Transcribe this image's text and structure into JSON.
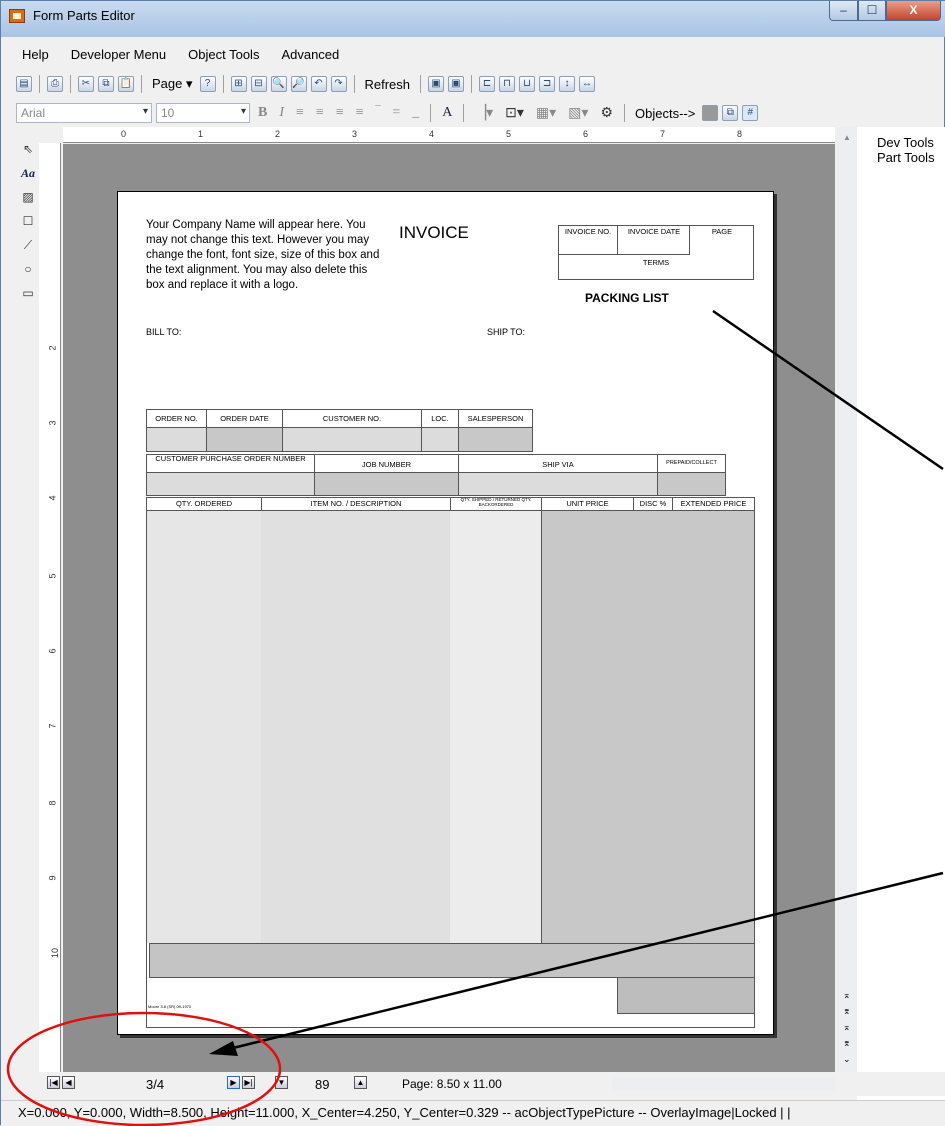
{
  "window": {
    "title": "Form Parts Editor",
    "min_label": "–",
    "max_label": "☐",
    "close_label": "X"
  },
  "menu": [
    "Help",
    "Developer Menu",
    "Object Tools",
    "Advanced"
  ],
  "toolbar1": {
    "page_label": "Page ▾",
    "refresh_label": "Refresh"
  },
  "toolbar2": {
    "font": "Arial",
    "size": "10",
    "objects_label": "Objects-->"
  },
  "right_panel": [
    "Dev Tools",
    "Part Tools"
  ],
  "ruler": {
    "horizontal": [
      "0",
      "1",
      "2",
      "3",
      "4",
      "5",
      "6",
      "7",
      "8"
    ],
    "vertical": [
      "2",
      "3",
      "4",
      "5",
      "6",
      "7",
      "8",
      "9",
      "10"
    ]
  },
  "form": {
    "company_text": "Your Company Name will appear here. You may not change this text. However you may change the font, font size, size of this box and the text alignment. You may also delete this box and replace it with a logo.",
    "title": "INVOICE",
    "packing_list": "PACKING LIST",
    "bill_to": "BILL TO:",
    "ship_to": "SHIP TO:",
    "top_box": {
      "invoice_no": "INVOICE NO.",
      "invoice_date": "INVOICE DATE",
      "page": "PAGE",
      "terms": "TERMS"
    },
    "row1": [
      "ORDER NO.",
      "ORDER DATE",
      "CUSTOMER NO.",
      "LOC.",
      "SALESPERSON"
    ],
    "row2": [
      "CUSTOMER PURCHASE ORDER NUMBER",
      "JOB NUMBER",
      "SHIP VIA",
      "PREPAID/COLLECT"
    ],
    "columns": [
      "QTY. ORDERED",
      "ITEM NO. / DESCRIPTION",
      "QTY. SHIPPED / RETURNED QTY. BACKORDERED",
      "UNIT PRICE",
      "DISC %",
      "EXTENDED PRICE"
    ],
    "footer_code": "Moore 3.8 (SR) 09-1970"
  },
  "navigation": {
    "page_counter": "3/4",
    "value": "89",
    "page_size": "Page: 8.50 x 11.00"
  },
  "status": "X=0.000, Y=0.000, Width=8.500, Height=11.000, X_Center=4.250, Y_Center=0.329 -- acObjectTypePicture -- OverlayImage|Locked  |  |",
  "colors": {
    "annotation_red": "#e01010",
    "canvas_gray": "#8e8e8e",
    "field_shade": "#dcdcdc"
  }
}
